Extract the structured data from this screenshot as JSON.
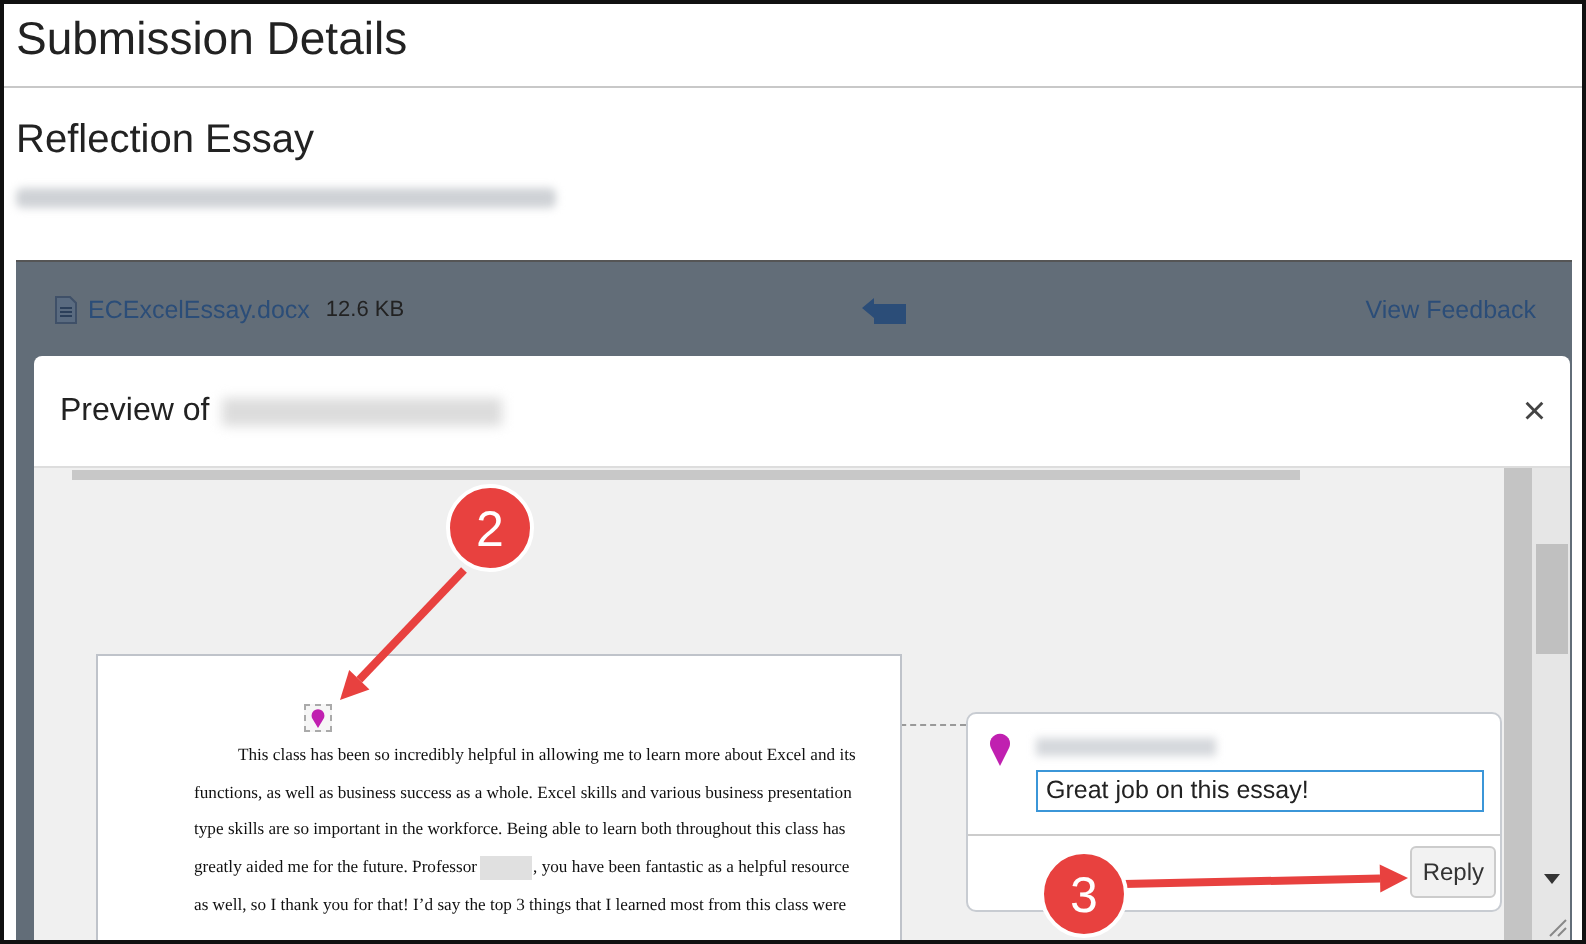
{
  "page": {
    "title": "Submission Details",
    "assignment_title": "Reflection Essay"
  },
  "file_bar": {
    "file_name": "ECExcelEssay.docx",
    "file_size": "12.6 KB",
    "view_feedback": "View Feedback"
  },
  "preview": {
    "title": "Preview of",
    "close": "×",
    "document_lines": [
      {
        "segments": [
          "This class has been so incredibly helpful in allowing me to learn more about Excel and its"
        ]
      },
      {
        "segments": [
          "functions, as well as business success as a whole. Excel skills and various business presentation"
        ]
      },
      {
        "segments": [
          "type skills are so important in the workforce. Being able to learn both throughout this class has"
        ]
      },
      {
        "segments": [
          "greatly aided me for the future. Professor",
          ", you have been fantastic as a helpful resource"
        ]
      },
      {
        "segments": [
          "as well, so I thank you for that! I’d say the top 3 things that I learned most from this class were"
        ]
      }
    ],
    "comment": {
      "text": "Great job on this essay!",
      "reply": "Reply"
    }
  },
  "callouts": [
    {
      "number": "2"
    },
    {
      "number": "3"
    }
  ]
}
